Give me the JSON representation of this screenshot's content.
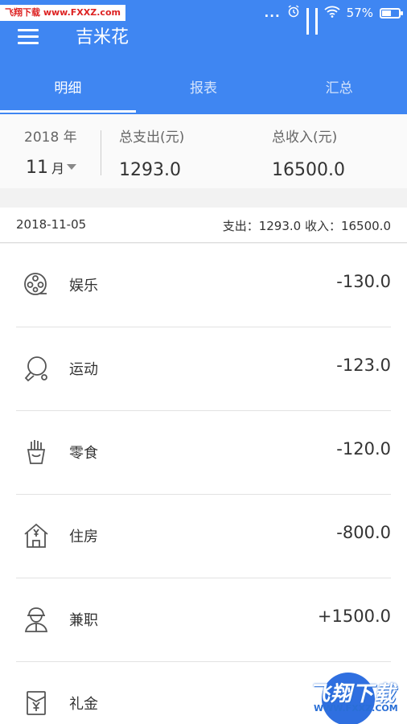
{
  "status_bar": {
    "watermark": "飞翔下载 www.FXXZ.com",
    "dots": "...",
    "battery": "57%",
    "battery_level": 0.57
  },
  "app": {
    "title": "吉米花"
  },
  "tabs": [
    {
      "label": "明细",
      "active": true
    },
    {
      "label": "报表",
      "active": false
    },
    {
      "label": "汇总",
      "active": false
    }
  ],
  "summary": {
    "year": "2018 年",
    "month": "11",
    "month_unit": "月",
    "expense_label": "总支出(元)",
    "expense_value": "1293.0",
    "income_label": "总收入(元)",
    "income_value": "16500.0"
  },
  "day": {
    "date": "2018-11-05",
    "totals": "支出：1293.0 收入：16500.0"
  },
  "items": [
    {
      "name": "娱乐",
      "amount": "-130.0",
      "icon": "film-reel-icon"
    },
    {
      "name": "运动",
      "amount": "-123.0",
      "icon": "ping-pong-icon"
    },
    {
      "name": "零食",
      "amount": "-120.0",
      "icon": "fries-icon"
    },
    {
      "name": "住房",
      "amount": "-800.0",
      "icon": "house-yen-icon"
    },
    {
      "name": "兼职",
      "amount": "+1500.0",
      "icon": "worker-icon"
    },
    {
      "name": "礼金",
      "amount": "",
      "icon": "red-envelope-icon"
    }
  ],
  "watermark_br": {
    "big": "飞翔下载",
    "small": "WWW.FXXZ.COM"
  },
  "colors": {
    "primary": "#3f86f2",
    "fab": "#2f6fe0"
  }
}
